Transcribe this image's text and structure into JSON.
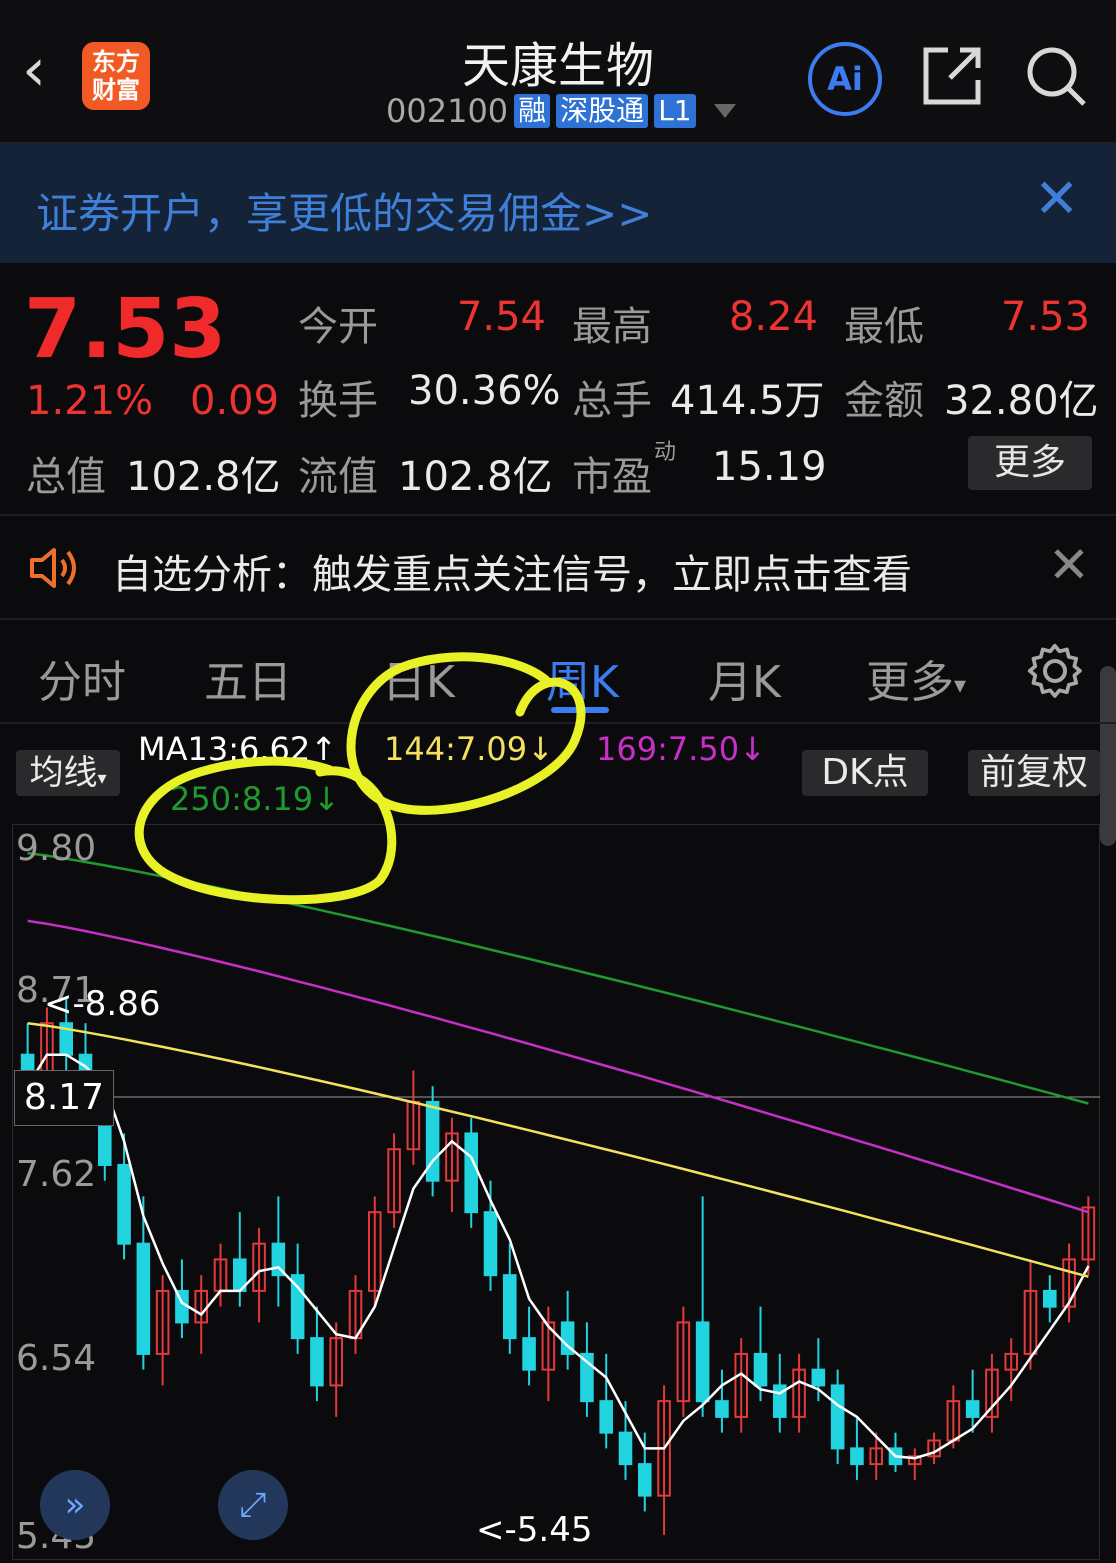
{
  "header": {
    "back_icon": "chevron-left-icon",
    "logo_line1": "东方",
    "logo_line2": "财富",
    "title": "天康生物",
    "code": "002100",
    "tags": [
      "融",
      "深股通",
      "L1"
    ],
    "ai_label": "Ai"
  },
  "banner": {
    "text": "证券开户，享更低的交易佣金>>"
  },
  "quote": {
    "price": "7.53",
    "change_pct": "1.21%",
    "change_abs": "0.09",
    "open_label": "今开",
    "open": "7.54",
    "high_label": "最高",
    "high": "8.24",
    "low_label": "最低",
    "low": "7.53",
    "turnover_label": "换手",
    "turnover": "30.36%",
    "volume_label": "总手",
    "volume": "414.5万",
    "amount_label": "金额",
    "amount": "32.80亿",
    "mktcap_label": "总值",
    "mktcap": "102.8亿",
    "float_label": "流值",
    "float": "102.8亿",
    "pe_label": "市盈",
    "pe_sup": "动",
    "pe": "15.19",
    "more_label": "更多"
  },
  "alert": {
    "text": "自选分析：触发重点关注信号，立即点击查看"
  },
  "tabs": [
    "分时",
    "五日",
    "日K",
    "周K",
    "月K",
    "更多"
  ],
  "chart": {
    "ma_button": "均线",
    "ma13": "MA13:6.62",
    "ma144": "144:7.09",
    "ma169": "169:7.50",
    "ma250": "250:8.19",
    "dk_button": "DK点",
    "adjust_button": "前复权",
    "y_labels": [
      "9.80",
      "8.71",
      "7.62",
      "6.54",
      "5.45"
    ],
    "crosshair_value": "8.17",
    "max_marker": "<-8.86",
    "min_marker": "<-5.45"
  },
  "colors": {
    "up": "#e23a3a",
    "down": "#22d3e0",
    "ma13": "#ffffff",
    "ma144": "#f2e25e",
    "ma169": "#c82fc8",
    "ma250": "#1e9a2e",
    "highlight": "#e8f227"
  },
  "chart_data": {
    "type": "candlestick",
    "title": "",
    "ylim": [
      5.45,
      9.8
    ],
    "yticks": [
      9.8,
      8.71,
      7.62,
      6.54,
      5.45
    ],
    "series": [
      {
        "name": "MA13",
        "value": 6.62
      },
      {
        "name": "144",
        "value": 7.09
      },
      {
        "name": "169",
        "value": 7.5
      },
      {
        "name": "250",
        "value": 8.19
      }
    ],
    "ohlc": [
      [
        8.5,
        8.7,
        8.1,
        8.3
      ],
      [
        8.3,
        8.8,
        8.2,
        8.7
      ],
      [
        8.7,
        8.86,
        8.4,
        8.5
      ],
      [
        8.5,
        8.7,
        8.1,
        8.2
      ],
      [
        8.2,
        8.4,
        7.7,
        7.8
      ],
      [
        7.8,
        8.0,
        7.2,
        7.3
      ],
      [
        7.3,
        7.6,
        6.5,
        6.6
      ],
      [
        6.6,
        7.1,
        6.4,
        7.0
      ],
      [
        7.0,
        7.2,
        6.7,
        6.8
      ],
      [
        6.8,
        7.1,
        6.6,
        7.0
      ],
      [
        7.0,
        7.3,
        6.9,
        7.2
      ],
      [
        7.2,
        7.5,
        6.9,
        7.0
      ],
      [
        7.0,
        7.4,
        6.8,
        7.3
      ],
      [
        7.3,
        7.6,
        6.9,
        7.1
      ],
      [
        7.1,
        7.3,
        6.6,
        6.7
      ],
      [
        6.7,
        6.9,
        6.3,
        6.4
      ],
      [
        6.4,
        6.8,
        6.2,
        6.7
      ],
      [
        6.7,
        7.1,
        6.6,
        7.0
      ],
      [
        7.0,
        7.6,
        6.9,
        7.5
      ],
      [
        7.5,
        8.0,
        7.4,
        7.9
      ],
      [
        7.9,
        8.4,
        7.8,
        8.2
      ],
      [
        8.2,
        8.3,
        7.6,
        7.7
      ],
      [
        7.7,
        8.1,
        7.5,
        8.0
      ],
      [
        8.0,
        8.1,
        7.4,
        7.5
      ],
      [
        7.5,
        7.7,
        7.0,
        7.1
      ],
      [
        7.1,
        7.3,
        6.6,
        6.7
      ],
      [
        6.7,
        6.9,
        6.4,
        6.5
      ],
      [
        6.5,
        6.9,
        6.3,
        6.8
      ],
      [
        6.8,
        7.0,
        6.5,
        6.6
      ],
      [
        6.6,
        6.8,
        6.2,
        6.3
      ],
      [
        6.3,
        6.6,
        6.0,
        6.1
      ],
      [
        6.1,
        6.3,
        5.8,
        5.9
      ],
      [
        5.9,
        6.1,
        5.6,
        5.7
      ],
      [
        5.7,
        6.4,
        5.45,
        6.3
      ],
      [
        6.3,
        6.9,
        6.2,
        6.8
      ],
      [
        6.8,
        7.6,
        6.2,
        6.3
      ],
      [
        6.3,
        6.5,
        6.1,
        6.2
      ],
      [
        6.2,
        6.7,
        6.1,
        6.6
      ],
      [
        6.6,
        6.9,
        6.3,
        6.4
      ],
      [
        6.4,
        6.6,
        6.1,
        6.2
      ],
      [
        6.2,
        6.6,
        6.1,
        6.5
      ],
      [
        6.5,
        6.7,
        6.3,
        6.4
      ],
      [
        6.4,
        6.5,
        5.9,
        6.0
      ],
      [
        6.0,
        6.2,
        5.8,
        5.9
      ],
      [
        5.9,
        6.1,
        5.8,
        6.0
      ],
      [
        6.0,
        6.1,
        5.85,
        5.9
      ],
      [
        5.9,
        6.0,
        5.8,
        5.95
      ],
      [
        5.95,
        6.1,
        5.9,
        6.05
      ],
      [
        6.05,
        6.4,
        6.0,
        6.3
      ],
      [
        6.3,
        6.5,
        6.1,
        6.2
      ],
      [
        6.2,
        6.6,
        6.1,
        6.5
      ],
      [
        6.5,
        6.7,
        6.3,
        6.6
      ],
      [
        6.6,
        7.2,
        6.5,
        7.0
      ],
      [
        7.0,
        7.1,
        6.8,
        6.9
      ],
      [
        6.9,
        7.3,
        6.8,
        7.2
      ],
      [
        7.2,
        7.6,
        7.1,
        7.53
      ]
    ]
  }
}
